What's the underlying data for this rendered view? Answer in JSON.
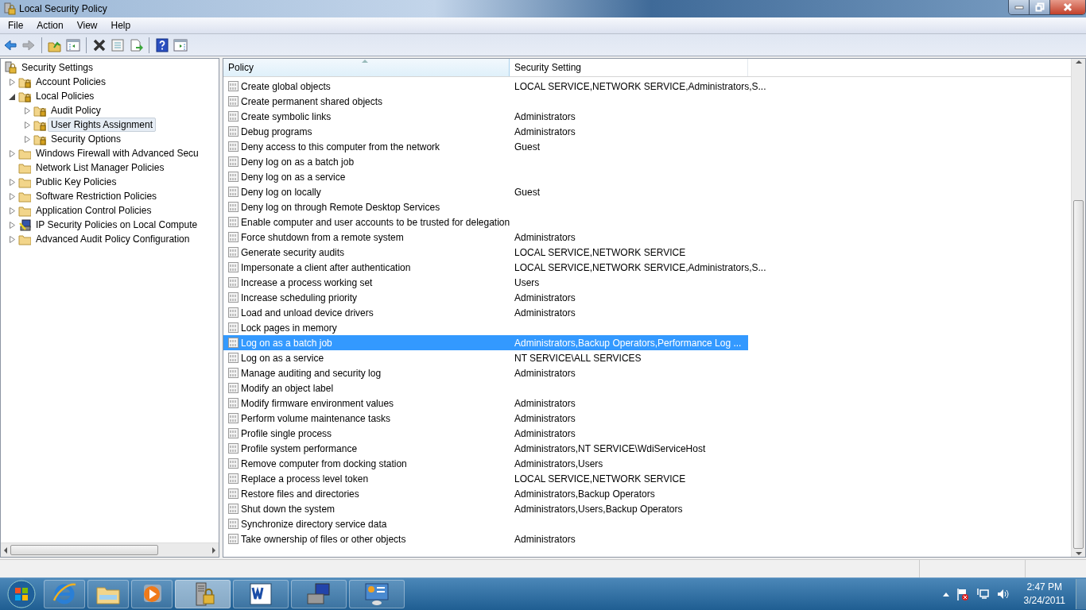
{
  "window": {
    "title": "Local Security Policy"
  },
  "menu": [
    "File",
    "Action",
    "View",
    "Help"
  ],
  "toolbar": [
    {
      "kind": "back",
      "disabled": false
    },
    {
      "kind": "forward",
      "disabled": true
    },
    {
      "kind": "sep"
    },
    {
      "kind": "up",
      "disabled": false
    },
    {
      "kind": "tree-toggle",
      "disabled": false
    },
    {
      "kind": "sep"
    },
    {
      "kind": "delete",
      "disabled": false
    },
    {
      "kind": "properties",
      "disabled": false
    },
    {
      "kind": "export",
      "disabled": false
    },
    {
      "kind": "sep"
    },
    {
      "kind": "help",
      "disabled": false
    },
    {
      "kind": "action-pane",
      "disabled": false
    }
  ],
  "tree": [
    {
      "label": "Security Settings",
      "kind": "root",
      "selected": false,
      "children": [
        {
          "label": "Account Policies",
          "kind": "folder-lock",
          "expanded": false,
          "selected": false
        },
        {
          "label": "Local Policies",
          "kind": "folder-lock",
          "expanded": true,
          "selected": false,
          "children": [
            {
              "label": "Audit Policy",
              "kind": "folder-lock",
              "expanded": false,
              "selected": false
            },
            {
              "label": "User Rights Assignment",
              "kind": "folder-lock",
              "expanded": false,
              "selected": true
            },
            {
              "label": "Security Options",
              "kind": "folder-lock",
              "expanded": false,
              "selected": false
            }
          ]
        },
        {
          "label": "Windows Firewall with Advanced Secu",
          "kind": "folder",
          "expanded": false,
          "selected": false
        },
        {
          "label": "Network List Manager Policies",
          "kind": "folder",
          "selected": false
        },
        {
          "label": "Public Key Policies",
          "kind": "folder",
          "expanded": false,
          "selected": false
        },
        {
          "label": "Software Restriction Policies",
          "kind": "folder",
          "expanded": false,
          "selected": false
        },
        {
          "label": "Application Control Policies",
          "kind": "folder",
          "expanded": false,
          "selected": false
        },
        {
          "label": "IP Security Policies on Local Compute",
          "kind": "ipsec",
          "expanded": false,
          "selected": false
        },
        {
          "label": "Advanced Audit Policy Configuration",
          "kind": "folder",
          "expanded": false,
          "selected": false
        }
      ]
    }
  ],
  "list": {
    "columns": [
      {
        "label": "Policy",
        "sorted": true
      },
      {
        "label": "Security Setting",
        "sorted": false
      }
    ],
    "rows": [
      {
        "policy": "Create global objects",
        "setting": "LOCAL SERVICE,NETWORK SERVICE,Administrators,S...",
        "selected": false
      },
      {
        "policy": "Create permanent shared objects",
        "selected": false
      },
      {
        "policy": "Create symbolic links",
        "setting": "Administrators",
        "selected": false
      },
      {
        "policy": "Debug programs",
        "setting": "Administrators",
        "selected": false
      },
      {
        "policy": "Deny access to this computer from the network",
        "setting": "Guest",
        "selected": false
      },
      {
        "policy": "Deny log on as a batch job",
        "selected": false
      },
      {
        "policy": "Deny log on as a service",
        "selected": false
      },
      {
        "policy": "Deny log on locally",
        "setting": "Guest",
        "selected": false
      },
      {
        "policy": "Deny log on through Remote Desktop Services",
        "selected": false
      },
      {
        "policy": "Enable computer and user accounts to be trusted for delegation",
        "selected": false
      },
      {
        "policy": "Force shutdown from a remote system",
        "setting": "Administrators",
        "selected": false
      },
      {
        "policy": "Generate security audits",
        "setting": "LOCAL SERVICE,NETWORK SERVICE",
        "selected": false
      },
      {
        "policy": "Impersonate a client after authentication",
        "setting": "LOCAL SERVICE,NETWORK SERVICE,Administrators,S...",
        "selected": false
      },
      {
        "policy": "Increase a process working set",
        "setting": "Users",
        "selected": false
      },
      {
        "policy": "Increase scheduling priority",
        "setting": "Administrators",
        "selected": false
      },
      {
        "policy": "Load and unload device drivers",
        "setting": "Administrators",
        "selected": false
      },
      {
        "policy": "Lock pages in memory",
        "selected": false
      },
      {
        "policy": "Log on as a batch job",
        "setting": "Administrators,Backup Operators,Performance Log ...",
        "selected": true
      },
      {
        "policy": "Log on as a service",
        "setting": "NT SERVICE\\ALL SERVICES",
        "selected": false
      },
      {
        "policy": "Manage auditing and security log",
        "setting": "Administrators",
        "selected": false
      },
      {
        "policy": "Modify an object label",
        "selected": false
      },
      {
        "policy": "Modify firmware environment values",
        "setting": "Administrators",
        "selected": false
      },
      {
        "policy": "Perform volume maintenance tasks",
        "setting": "Administrators",
        "selected": false
      },
      {
        "policy": "Profile single process",
        "setting": "Administrators",
        "selected": false
      },
      {
        "policy": "Profile system performance",
        "setting": "Administrators,NT SERVICE\\WdiServiceHost",
        "selected": false
      },
      {
        "policy": "Remove computer from docking station",
        "setting": "Administrators,Users",
        "selected": false
      },
      {
        "policy": "Replace a process level token",
        "setting": "LOCAL SERVICE,NETWORK SERVICE",
        "selected": false
      },
      {
        "policy": "Restore files and directories",
        "setting": "Administrators,Backup Operators",
        "selected": false
      },
      {
        "policy": "Shut down the system",
        "setting": "Administrators,Users,Backup Operators",
        "selected": false
      },
      {
        "policy": "Synchronize directory service data",
        "selected": false
      },
      {
        "policy": "Take ownership of files or other objects",
        "setting": "Administrators",
        "selected": false
      }
    ]
  },
  "taskbar": [
    {
      "kind": "browser",
      "active": false
    },
    {
      "kind": "explorer",
      "active": false
    },
    {
      "kind": "media",
      "active": false
    },
    {
      "kind": "security-policy",
      "active": true
    },
    {
      "kind": "word",
      "active": false
    },
    {
      "kind": "remote",
      "active": false
    },
    {
      "kind": "control-panel",
      "active": false
    }
  ],
  "clock": {
    "time": "2:47 PM",
    "date": "3/24/2011"
  }
}
